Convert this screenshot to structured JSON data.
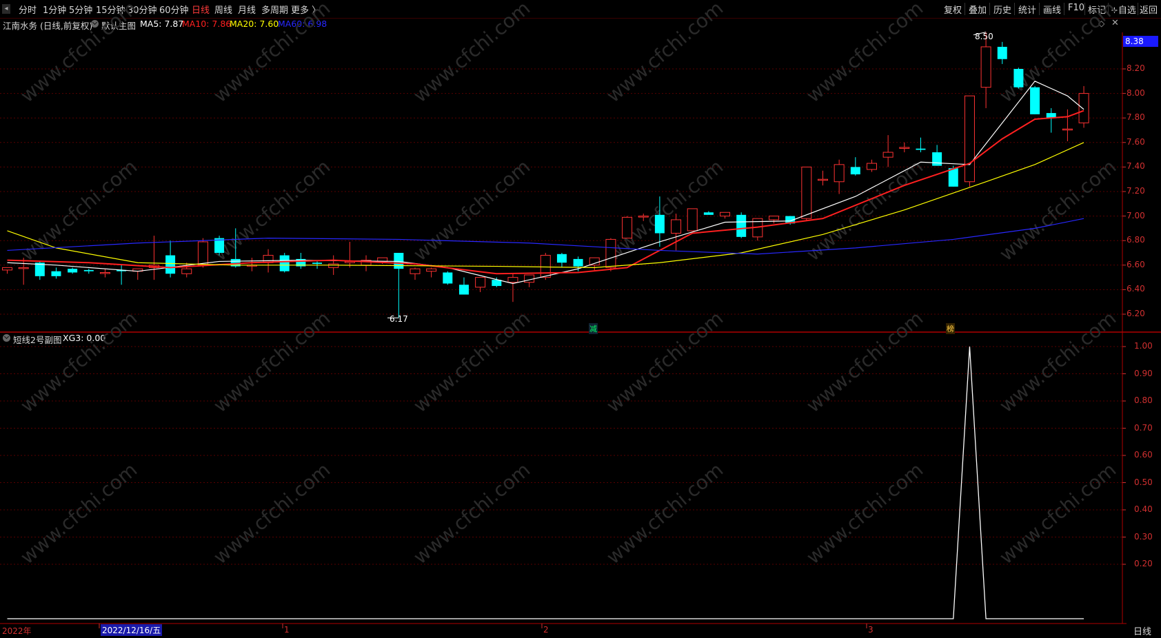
{
  "toolbar": {
    "left_tabs": [
      "分时",
      "1分钟",
      "5分钟",
      "15分钟",
      "30分钟",
      "60分钟",
      "日线",
      "周线",
      "月线",
      "多周期",
      "更多 〉"
    ],
    "active_tab": "日线",
    "right_tabs": [
      "复权",
      "叠加",
      "历史",
      "统计",
      "画线",
      "F10",
      "标记",
      "+自选",
      "返回"
    ]
  },
  "main_panel": {
    "title": "江南水务 (日线,前复权)",
    "indicator_name": "默认主图",
    "ma": [
      {
        "label": "MA5: 7.87",
        "color": "#ffffff"
      },
      {
        "label": "MA10: 7.86",
        "color": "#ff2020"
      },
      {
        "label": "MA20: 7.60",
        "color": "#ffff00"
      },
      {
        "label": "MA60: 6.98",
        "color": "#2828ff"
      }
    ],
    "price_tag": "8.38",
    "y_ticks": [
      "8.20",
      "8.00",
      "7.80",
      "7.60",
      "7.40",
      "7.20",
      "7.00",
      "6.80",
      "6.60",
      "6.40",
      "6.20"
    ],
    "high_label": "8.50",
    "low_label": "6.17",
    "markers": [
      "减",
      "榜"
    ]
  },
  "sub_panel": {
    "title": "短线2号副图",
    "value_label": "XG3: 0.00",
    "y_ticks": [
      "1.00",
      "0.90",
      "0.80",
      "0.70",
      "0.60",
      "0.50",
      "0.40",
      "0.30",
      "0.20"
    ]
  },
  "date_axis": {
    "labels": [
      "2022年",
      "2022/12/16/五",
      "1",
      "2",
      "3"
    ]
  },
  "period_badge": "日线",
  "watermark": "www.cfchi.com",
  "colors": {
    "up": "#ff3232",
    "down": "#00ffff",
    "grid": "#5a0000",
    "axis": "#d23030"
  },
  "chart_data": {
    "type": "candlestick",
    "candles": [
      [
        6.56,
        6.58,
        6.53,
        6.58
      ],
      [
        6.58,
        6.66,
        6.44,
        6.58
      ],
      [
        6.62,
        6.63,
        6.48,
        6.51
      ],
      [
        6.55,
        6.58,
        6.49,
        6.51
      ],
      [
        6.57,
        6.58,
        6.53,
        6.54
      ],
      [
        6.56,
        6.57,
        6.53,
        6.55
      ],
      [
        6.54,
        6.57,
        6.5,
        6.54
      ],
      [
        6.56,
        6.6,
        6.44,
        6.55
      ],
      [
        6.55,
        6.56,
        6.48,
        6.57
      ],
      [
        6.58,
        6.84,
        6.48,
        6.6
      ],
      [
        6.68,
        6.8,
        6.5,
        6.53
      ],
      [
        6.53,
        6.62,
        6.5,
        6.57
      ],
      [
        6.6,
        6.82,
        6.58,
        6.79
      ],
      [
        6.82,
        6.84,
        6.68,
        6.7
      ],
      [
        6.65,
        6.9,
        6.58,
        6.59
      ],
      [
        6.6,
        6.66,
        6.55,
        6.6
      ],
      [
        6.62,
        6.73,
        6.54,
        6.68
      ],
      [
        6.68,
        6.7,
        6.54,
        6.55
      ],
      [
        6.65,
        6.7,
        6.57,
        6.59
      ],
      [
        6.62,
        6.63,
        6.57,
        6.61
      ],
      [
        6.58,
        6.68,
        6.52,
        6.61
      ],
      [
        6.62,
        6.79,
        6.58,
        6.63
      ],
      [
        6.6,
        6.68,
        6.55,
        6.64
      ],
      [
        6.63,
        6.66,
        6.61,
        6.66
      ],
      [
        6.7,
        6.7,
        6.17,
        6.57
      ],
      [
        6.53,
        6.58,
        6.48,
        6.57
      ],
      [
        6.55,
        6.58,
        6.5,
        6.57
      ],
      [
        6.54,
        6.55,
        6.44,
        6.45
      ],
      [
        6.44,
        6.5,
        6.36,
        6.36
      ],
      [
        6.42,
        6.5,
        6.38,
        6.5
      ],
      [
        6.48,
        6.5,
        6.42,
        6.43
      ],
      [
        6.46,
        6.53,
        6.3,
        6.5
      ],
      [
        6.46,
        6.52,
        6.42,
        6.52
      ],
      [
        6.5,
        6.7,
        6.48,
        6.68
      ],
      [
        6.69,
        6.7,
        6.58,
        6.62
      ],
      [
        6.65,
        6.67,
        6.55,
        6.59
      ],
      [
        6.6,
        6.66,
        6.56,
        6.66
      ],
      [
        6.58,
        6.82,
        6.55,
        6.81
      ],
      [
        6.82,
        7.0,
        6.82,
        6.99
      ],
      [
        7.0,
        7.02,
        6.96,
        7.0
      ],
      [
        7.01,
        7.16,
        6.75,
        6.86
      ],
      [
        6.86,
        7.02,
        6.72,
        6.97
      ],
      [
        6.88,
        7.06,
        6.88,
        7.06
      ],
      [
        7.03,
        7.04,
        7.02,
        7.01
      ],
      [
        7.0,
        7.03,
        6.98,
        7.03
      ],
      [
        7.01,
        7.03,
        6.82,
        6.83
      ],
      [
        6.83,
        6.98,
        6.8,
        6.98
      ],
      [
        6.97,
        7.0,
        6.94,
        7.0
      ],
      [
        7.0,
        7.0,
        6.93,
        6.94
      ],
      [
        6.98,
        7.4,
        6.96,
        7.4
      ],
      [
        7.3,
        7.37,
        7.25,
        7.3
      ],
      [
        7.28,
        7.46,
        7.18,
        7.42
      ],
      [
        7.4,
        7.48,
        7.33,
        7.34
      ],
      [
        7.38,
        7.46,
        7.36,
        7.43
      ],
      [
        7.48,
        7.66,
        7.4,
        7.52
      ],
      [
        7.56,
        7.6,
        7.52,
        7.56
      ],
      [
        7.55,
        7.64,
        7.52,
        7.54
      ],
      [
        7.52,
        7.58,
        7.41,
        7.41
      ],
      [
        7.39,
        7.41,
        7.24,
        7.24
      ],
      [
        7.28,
        7.98,
        7.24,
        7.98
      ],
      [
        8.05,
        8.5,
        7.88,
        8.38
      ],
      [
        8.38,
        8.42,
        8.24,
        8.28
      ],
      [
        8.2,
        8.21,
        8.04,
        8.05
      ],
      [
        8.05,
        8.06,
        7.83,
        7.83
      ],
      [
        7.84,
        7.88,
        7.68,
        7.8
      ],
      [
        7.71,
        7.87,
        7.61,
        7.71
      ],
      [
        7.76,
        8.06,
        7.72,
        8.0
      ]
    ],
    "ma_series": {
      "MA5": {
        "color": "#ffffff",
        "points": [
          [
            0,
            6.62
          ],
          [
            3,
            6.6
          ],
          [
            8,
            6.55
          ],
          [
            13,
            6.63
          ],
          [
            18,
            6.64
          ],
          [
            24,
            6.63
          ],
          [
            27,
            6.58
          ],
          [
            31,
            6.45
          ],
          [
            35,
            6.57
          ],
          [
            40,
            6.79
          ],
          [
            44,
            6.95
          ],
          [
            48,
            6.96
          ],
          [
            52,
            7.16
          ],
          [
            56,
            7.44
          ],
          [
            59,
            7.42
          ],
          [
            63,
            8.1
          ],
          [
            65,
            7.98
          ],
          [
            66,
            7.87
          ]
        ]
      },
      "MA10": {
        "color": "#ff2020",
        "points": [
          [
            0,
            6.64
          ],
          [
            5,
            6.62
          ],
          [
            10,
            6.58
          ],
          [
            15,
            6.62
          ],
          [
            20,
            6.64
          ],
          [
            25,
            6.61
          ],
          [
            30,
            6.53
          ],
          [
            35,
            6.54
          ],
          [
            38,
            6.58
          ],
          [
            42,
            6.86
          ],
          [
            46,
            6.91
          ],
          [
            50,
            6.98
          ],
          [
            55,
            7.25
          ],
          [
            59,
            7.43
          ],
          [
            61,
            7.63
          ],
          [
            63,
            7.79
          ],
          [
            65,
            7.81
          ],
          [
            66,
            7.86
          ]
        ]
      },
      "MA20": {
        "color": "#ffff00",
        "points": [
          [
            0,
            6.88
          ],
          [
            3,
            6.74
          ],
          [
            8,
            6.62
          ],
          [
            14,
            6.6
          ],
          [
            20,
            6.6
          ],
          [
            30,
            6.59
          ],
          [
            36,
            6.58
          ],
          [
            40,
            6.62
          ],
          [
            45,
            6.7
          ],
          [
            50,
            6.85
          ],
          [
            55,
            7.05
          ],
          [
            60,
            7.28
          ],
          [
            63,
            7.42
          ],
          [
            66,
            7.6
          ]
        ]
      },
      "MA60": {
        "color": "#2828ff",
        "points": [
          [
            0,
            6.72
          ],
          [
            8,
            6.78
          ],
          [
            16,
            6.82
          ],
          [
            24,
            6.81
          ],
          [
            32,
            6.78
          ],
          [
            40,
            6.72
          ],
          [
            46,
            6.69
          ],
          [
            52,
            6.74
          ],
          [
            58,
            6.81
          ],
          [
            63,
            6.9
          ],
          [
            66,
            6.98
          ]
        ]
      }
    },
    "XG3": {
      "points": [
        [
          0,
          0
        ],
        [
          58,
          0
        ],
        [
          59,
          1
        ],
        [
          60,
          0
        ],
        [
          66,
          0
        ]
      ]
    }
  }
}
